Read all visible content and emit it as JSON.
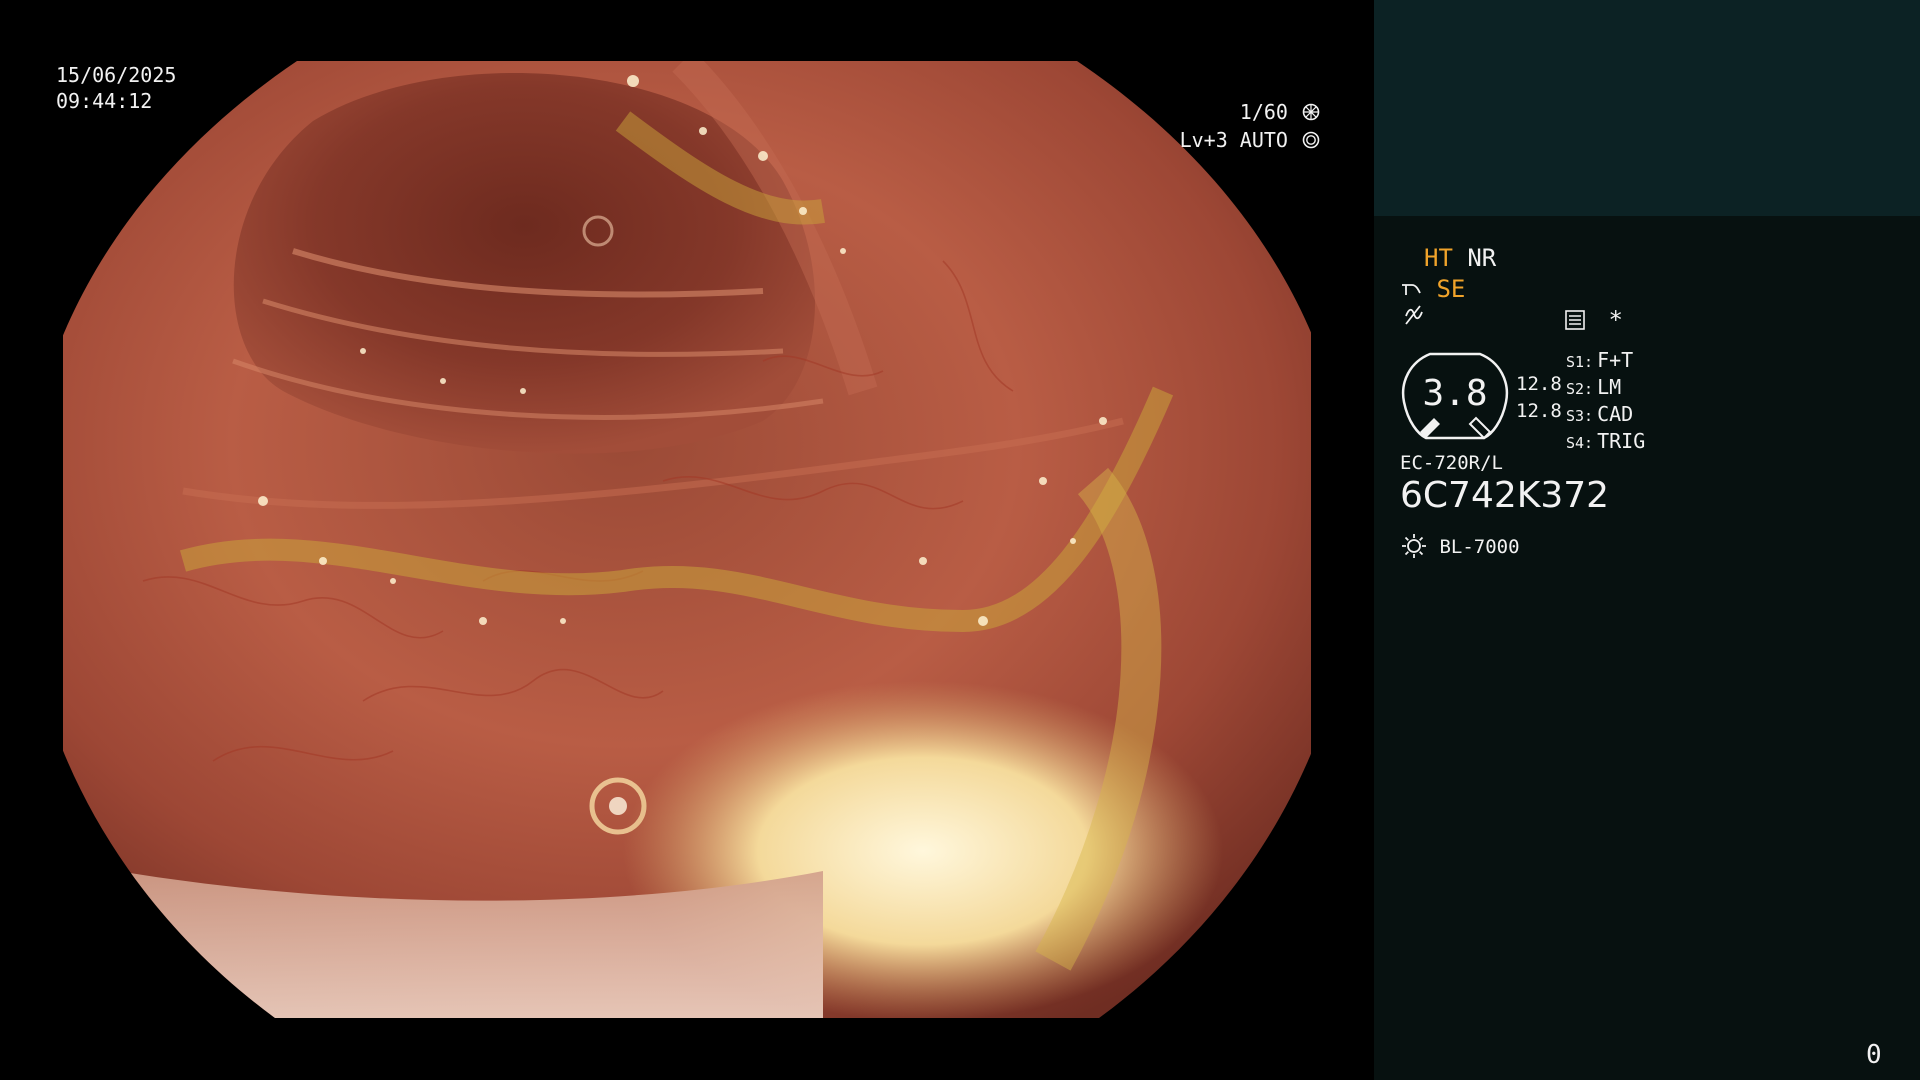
{
  "osd": {
    "date": "15/06/2025",
    "time": "09:44:12",
    "shutter": "1/60",
    "level": "Lv+3 AUTO"
  },
  "panel": {
    "ht": "HT",
    "nr": "NR",
    "se": "SE",
    "dial_value": "3.8",
    "side_values": [
      "12.8",
      "12.8"
    ],
    "settings": [
      {
        "key": "S1:",
        "value": "F+T"
      },
      {
        "key": "S2:",
        "value": "LM"
      },
      {
        "key": "S3:",
        "value": "CAD"
      },
      {
        "key": "S4:",
        "value": "TRIG"
      }
    ],
    "model": "EC-720R/L",
    "serial": "6C742K372",
    "light_source": "BL-7000",
    "star": "*",
    "counter": "0"
  },
  "colors": {
    "panel_top": "#0c2224",
    "panel": "#071110",
    "accent": "#f0a32a",
    "text": "#f2f2f2"
  },
  "icons": [
    "shutter-icon",
    "auto-icon",
    "scope-mode-icon",
    "freeze-icon",
    "memory-icon",
    "light-icon"
  ]
}
